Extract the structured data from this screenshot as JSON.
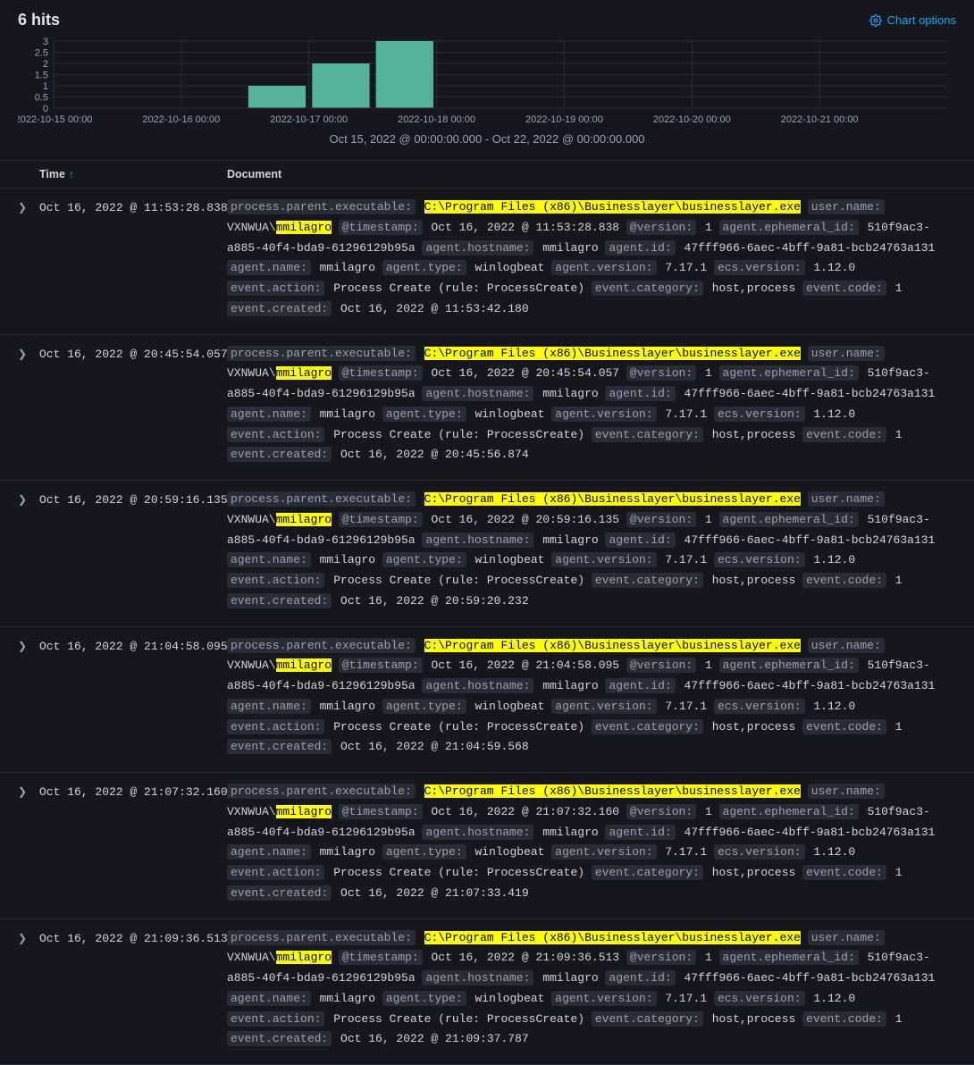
{
  "header": {
    "hits_label": "6 hits",
    "chart_options_label": "Chart options"
  },
  "chart_data": {
    "type": "bar",
    "categories": [
      "2022-10-15 00:00",
      "2022-10-16 00:00",
      "2022-10-17 00:00",
      "2022-10-18 00:00",
      "2022-10-19 00:00",
      "2022-10-20 00:00",
      "2022-10-21 00:00"
    ],
    "sub_bars_per_category": 2,
    "values_dense": [
      0,
      0,
      0,
      1,
      2,
      3,
      0,
      0,
      0,
      0,
      0,
      0,
      0,
      0
    ],
    "yticks": [
      0,
      0.5,
      1,
      1.5,
      2,
      2.5,
      3
    ],
    "ylim": [
      0,
      3
    ],
    "title": "",
    "xlabel": "",
    "ylabel": "",
    "range_label": "Oct 15, 2022 @ 00:00:00.000 - Oct 22, 2022 @ 00:00:00.000"
  },
  "columns": {
    "time": "Time",
    "document": "Document"
  },
  "highlight_exec": "C:\\Program Files (x86)\\Businesslayer\\businesslayer.exe",
  "highlight_user": "mmilagro",
  "user_prefix": "VXNWUA\\",
  "common": {
    "version": "1",
    "agent_ephemeral_id": "510f9ac3-a885-40f4-bda9-61296129b95a",
    "agent_hostname": "mmilagro",
    "agent_id": "47fff966-6aec-4bff-9a81-bcb24763a131",
    "agent_name": "mmilagro",
    "agent_type": "winlogbeat",
    "agent_version": "7.17.1",
    "ecs_version": "1.12.0",
    "event_action": "Process Create (rule: ProcessCreate)",
    "event_category": "host,process",
    "event_code": "1"
  },
  "rows": [
    {
      "time": "Oct 16, 2022 @ 11:53:28.838",
      "timestamp": "Oct 16, 2022 @ 11:53:28.838",
      "event_created": "Oct 16, 2022 @ 11:53:42.180"
    },
    {
      "time": "Oct 16, 2022 @ 20:45:54.057",
      "timestamp": "Oct 16, 2022 @ 20:45:54.057",
      "event_created": "Oct 16, 2022 @ 20:45:56.874"
    },
    {
      "time": "Oct 16, 2022 @ 20:59:16.135",
      "timestamp": "Oct 16, 2022 @ 20:59:16.135",
      "event_created": "Oct 16, 2022 @ 20:59:20.232"
    },
    {
      "time": "Oct 16, 2022 @ 21:04:58.095",
      "timestamp": "Oct 16, 2022 @ 21:04:58.095",
      "event_created": "Oct 16, 2022 @ 21:04:59.568"
    },
    {
      "time": "Oct 16, 2022 @ 21:07:32.160",
      "timestamp": "Oct 16, 2022 @ 21:07:32.160",
      "event_created": "Oct 16, 2022 @ 21:07:33.419"
    },
    {
      "time": "Oct 16, 2022 @ 21:09:36.513",
      "timestamp": "Oct 16, 2022 @ 21:09:36.513",
      "event_created": "Oct 16, 2022 @ 21:09:37.787"
    }
  ]
}
